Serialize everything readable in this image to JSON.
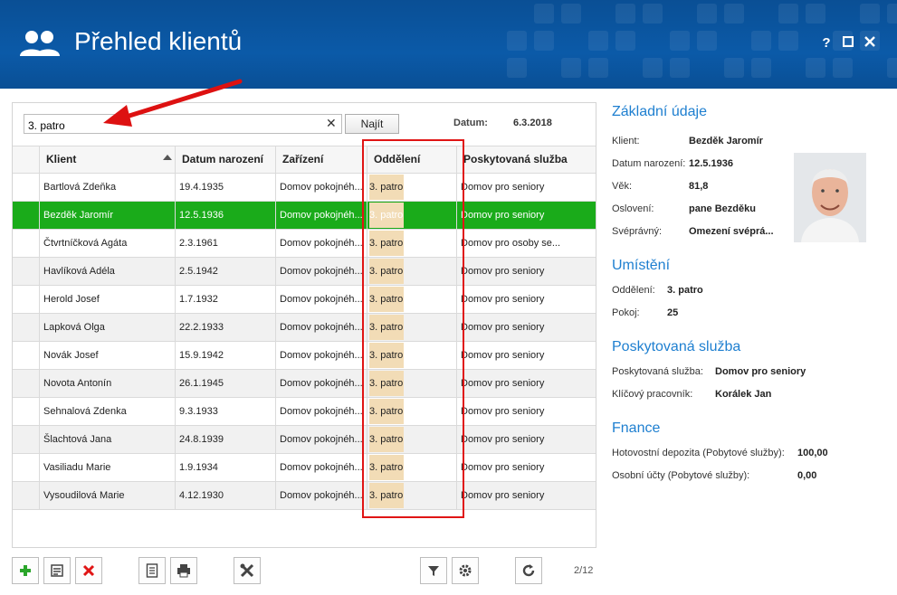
{
  "window": {
    "title": "Přehled klientů",
    "help": "?",
    "maximize": "□",
    "close": "✕"
  },
  "search": {
    "value": "3. patro",
    "clear": "✕",
    "find_label": "Najít"
  },
  "date": {
    "label": "Datum:",
    "value": "6.3.2018"
  },
  "grid": {
    "headers": [
      "Klient",
      "Datum narození",
      "Zařízení",
      "Oddělení",
      "Poskytovaná služba"
    ],
    "rows": [
      [
        "Bartlová Zdeňka",
        "19.4.1935",
        "Domov pokojnéh...",
        "3. patro",
        "Domov pro seniory"
      ],
      [
        "Bezděk Jaromír",
        "12.5.1936",
        "Domov pokojnéh...",
        "3. patro",
        "Domov pro seniory"
      ],
      [
        "Čtvrtníčková Agáta",
        "2.3.1961",
        "Domov pokojnéh...",
        "3. patro",
        "Domov pro osoby se..."
      ],
      [
        "Havlíková Adéla",
        "2.5.1942",
        "Domov pokojnéh...",
        "3. patro",
        "Domov pro seniory"
      ],
      [
        "Herold Josef",
        "1.7.1932",
        "Domov pokojnéh...",
        "3. patro",
        "Domov pro seniory"
      ],
      [
        "Lapková Olga",
        "22.2.1933",
        "Domov pokojnéh...",
        "3. patro",
        "Domov pro seniory"
      ],
      [
        "Novák Josef",
        "15.9.1942",
        "Domov pokojnéh...",
        "3. patro",
        "Domov pro seniory"
      ],
      [
        "Novota Antonín",
        "26.1.1945",
        "Domov pokojnéh...",
        "3. patro",
        "Domov pro seniory"
      ],
      [
        "Sehnalová Zdenka",
        "9.3.1933",
        "Domov pokojnéh...",
        "3. patro",
        "Domov pro seniory"
      ],
      [
        "Šlachtová Jana",
        "24.8.1939",
        "Domov pokojnéh...",
        "3. patro",
        "Domov pro seniory"
      ],
      [
        "Vasiliadu Marie",
        "1.9.1934",
        "Domov pokojnéh...",
        "3. patro",
        "Domov pro seniory"
      ],
      [
        "Vysoudilová Marie",
        "4.12.1930",
        "Domov pokojnéh...",
        "3. patro",
        "Domov pro seniory"
      ]
    ],
    "selected_index": 1,
    "selection_color": "#1aab1a",
    "highlight_color": "#f2dcb6"
  },
  "toolbar": {
    "icons": [
      "plus-icon",
      "edit-icon",
      "delete-icon",
      "document-icon",
      "print-icon",
      "tools-icon",
      "filter-icon",
      "settings-icon",
      "refresh-icon"
    ],
    "pager": "2/12"
  },
  "details": {
    "basic": {
      "title": "Základní údaje",
      "klient_label": "Klient:",
      "klient": "Bezděk Jaromír",
      "dob_label": "Datum narození:",
      "dob": "12.5.1936",
      "age_label": "Věk:",
      "age": "81,8",
      "greeting_label": "Oslovení:",
      "greeting": "pane Bezděku",
      "legal_label": "Svéprávný:",
      "legal": "Omezení svéprá..."
    },
    "placement": {
      "title": "Umístění",
      "dept_label": "Oddělení:",
      "dept": "3. patro",
      "room_label": "Pokoj:",
      "room": "25"
    },
    "service": {
      "title": "Poskytovaná služba",
      "service_label": "Poskytovaná služba:",
      "service": "Domov pro seniory",
      "worker_label": "Klíčový pracovník:",
      "worker": "Korálek Jan"
    },
    "finance": {
      "title": "Fnance",
      "deposit_label": "Hotovostní depozita (Pobytové služby):",
      "deposit": "100,00",
      "accounts_label": "Osobní účty (Pobytové služby):",
      "accounts": "0,00"
    }
  },
  "colors": {
    "titlebar": "#0b5aa8",
    "accent": "#1e7fd0",
    "annotation": "#e01515"
  }
}
